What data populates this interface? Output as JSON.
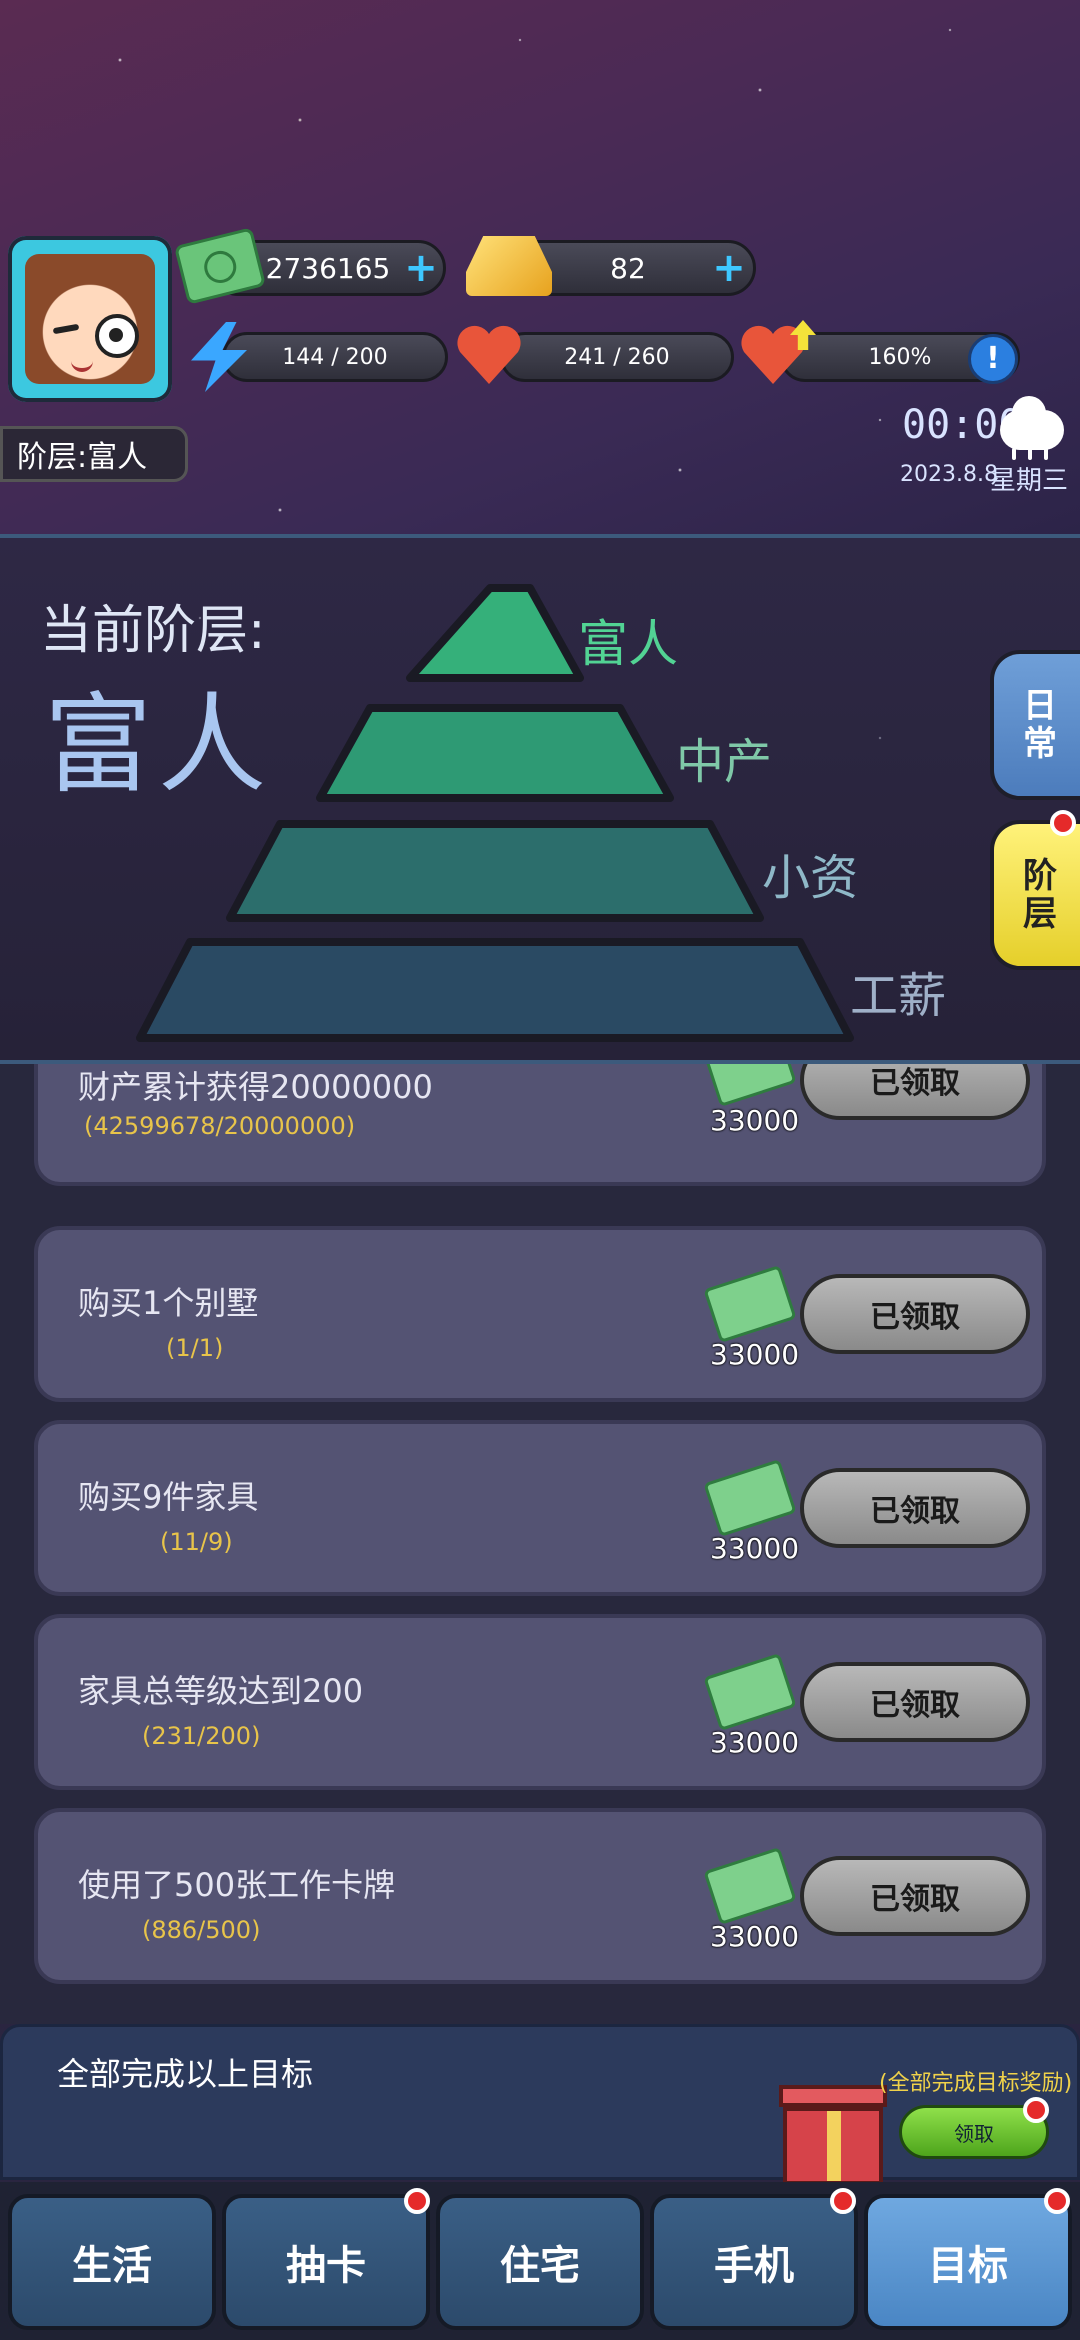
{
  "header": {
    "money": "2736165",
    "gold": "82",
    "energy": "144 / 200",
    "health": "241 / 260",
    "bonus_rate": "160%",
    "rank_label": "阶层:富人",
    "clock": "00:00",
    "date": "2023.8.8",
    "weekday": "星期三",
    "plus_symbol": "+",
    "info_symbol": "!"
  },
  "pyramid": {
    "current_label": "当前阶层:",
    "current_value": "富人",
    "levels": [
      "富人",
      "中产",
      "小资",
      "工薪"
    ],
    "level_colors": [
      "#35b07a",
      "#2e9a74",
      "#2c6e6c",
      "#2a4a63"
    ]
  },
  "side_tabs": [
    "日常",
    "阶层"
  ],
  "tasks": [
    {
      "title": "财产累计获得20000000",
      "progress": "(42599678/20000000)",
      "reward": "33000",
      "button": "已领取"
    },
    {
      "title": "购买1个别墅",
      "progress": "(1/1)",
      "reward": "33000",
      "button": "已领取"
    },
    {
      "title": "购买9件家具",
      "progress": "(11/9)",
      "reward": "33000",
      "button": "已领取"
    },
    {
      "title": "家具总等级达到200",
      "progress": "(231/200)",
      "reward": "33000",
      "button": "已领取"
    },
    {
      "title": "使用了500张工作卡牌",
      "progress": "(886/500)",
      "reward": "33000",
      "button": "已领取"
    }
  ],
  "complete_all": {
    "title": "全部完成以上目标",
    "reward_label": "(全部完成目标奖励)",
    "button": "领取"
  },
  "nav": [
    "生活",
    "抽卡",
    "住宅",
    "手机",
    "目标"
  ]
}
